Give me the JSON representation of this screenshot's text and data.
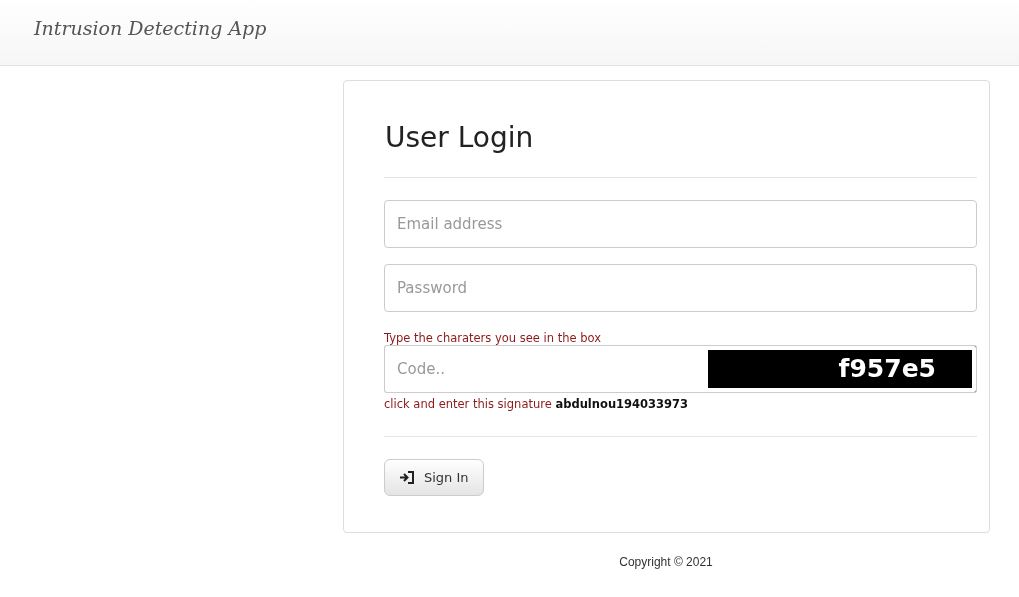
{
  "navbar": {
    "brand": "Intrusion Detecting App"
  },
  "login": {
    "title": "User Login",
    "fields": [
      {
        "placeholder": "Email address"
      },
      {
        "placeholder": "Password"
      }
    ],
    "captcha": {
      "instruction": "Type the charaters you see in the box",
      "placeholder": "Code..",
      "code": "f957e5"
    },
    "signature_note": "click and enter this signature **abdulnou194033973**",
    "button": "Sign In"
  },
  "footer": "Copyright © 2021"
}
